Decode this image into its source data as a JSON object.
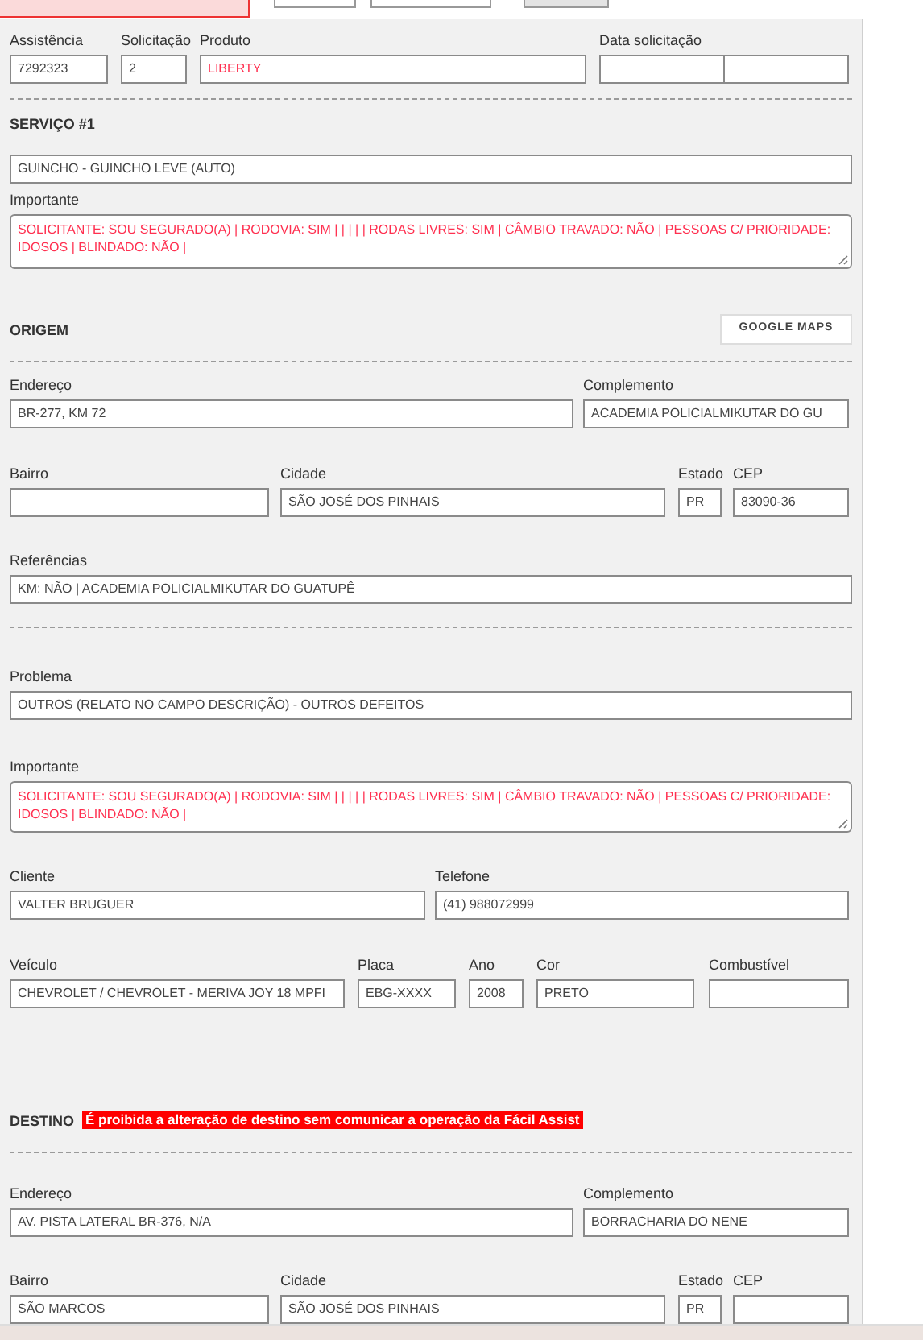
{
  "header": {
    "fields": [
      {
        "label": "Assistência",
        "value": "7292323",
        "emphasis": false
      },
      {
        "label": "Solicitação",
        "value": "2",
        "emphasis": false
      },
      {
        "label": "Produto",
        "value": "LIBERTY",
        "emphasis": true
      },
      {
        "label": "Data solicitação"
      }
    ]
  },
  "service": {
    "title": "SERVIÇO #1",
    "value": "GUINCHO - GUINCHO LEVE (AUTO)",
    "notes": {
      "label": "Importante",
      "value": "SOLICITANTE: SOU SEGURADO(A) | RODOVIA: SIM |  |  |  |  | RODAS LIVRES: SIM | CÂMBIO TRAVADO: NÃO | PESSOAS C/ PRIORIDADE: IDOSOS | BLINDADO: NÃO |",
      "emphasis": true
    }
  },
  "origin": {
    "title": "ORIGEM",
    "map_button": "GOOGLE MAPS",
    "address_row": [
      {
        "label": "Endereço",
        "value": "BR-277, KM 72"
      },
      {
        "label": "Complemento",
        "value": "ACADEMIA POLICIALMIKUTAR DO GU"
      }
    ],
    "district_row": [
      {
        "label": "Bairro"
      },
      {
        "label": "Cidade",
        "value": "SÃO JOSÉ DOS PINHAIS"
      },
      {
        "label": "Estado",
        "value": "PR"
      },
      {
        "label": "CEP",
        "value": "83090-36"
      }
    ],
    "references": {
      "label": "Referências",
      "value": "KM: NÃO | ACADEMIA POLICIALMIKUTAR DO GUATUPÊ"
    }
  },
  "problem": {
    "label": "Problema",
    "value": "OUTROS (RELATO NO CAMPO DESCRIÇÃO) - OUTROS DEFEITOS"
  },
  "problem_notes": {
    "label": "Importante",
    "value": "SOLICITANTE: SOU SEGURADO(A) | RODOVIA: SIM |  |  |  |  | RODAS LIVRES: SIM | CÂMBIO TRAVADO: NÃO | PESSOAS C/ PRIORIDADE: IDOSOS | BLINDADO: NÃO |",
    "emphasis": true
  },
  "client_row": [
    {
      "label": "Cliente",
      "value": "VALTER BRUGUER"
    },
    {
      "label": "Telefone",
      "value": "(41) 988072999"
    }
  ],
  "vehicle_row": [
    {
      "label": "Veículo",
      "value": "CHEVROLET / CHEVROLET - MERIVA JOY 18 MPFI"
    },
    {
      "label": "Placa",
      "value": "EBG-XXXX"
    },
    {
      "label": "Ano",
      "value": "2008"
    },
    {
      "label": "Cor",
      "value": "PRETO"
    },
    {
      "label": "Combustível"
    }
  ],
  "destination": {
    "title": "DESTINO",
    "warning": "É proibida a alteração de destino sem comunicar a operação da Fácil Assist",
    "address_row": [
      {
        "label": "Endereço",
        "value": "AV. PISTA LATERAL BR-376, N/A"
      },
      {
        "label": "Complemento",
        "value": "BORRACHARIA DO NENE"
      }
    ],
    "district_row": [
      {
        "label": "Bairro",
        "value": "SÃO MARCOS"
      },
      {
        "label": "Cidade",
        "value": "SÃO JOSÉ DOS PINHAIS"
      },
      {
        "label": "Estado",
        "value": "PR"
      },
      {
        "label": "CEP"
      }
    ]
  }
}
